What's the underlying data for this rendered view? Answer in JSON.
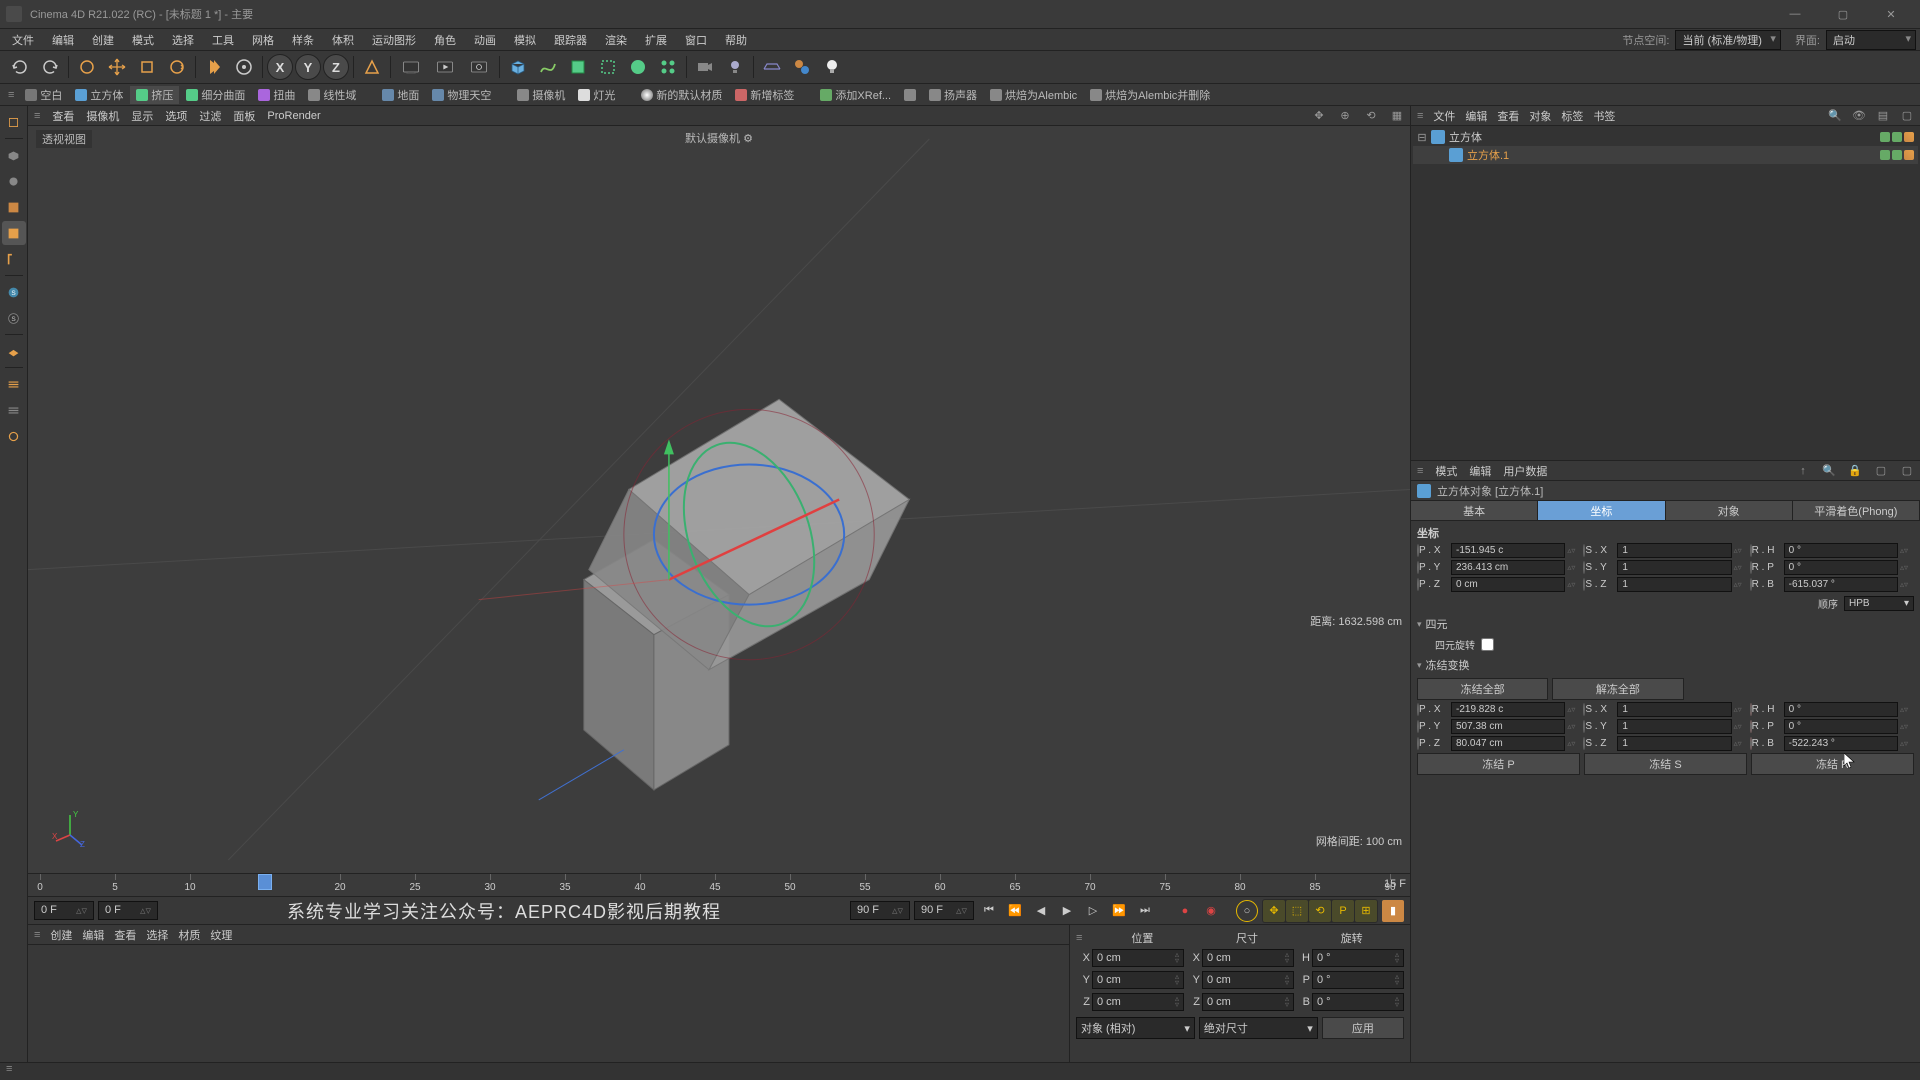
{
  "window": {
    "title": "Cinema 4D R21.022 (RC) - [未标题 1 *] - 主要"
  },
  "menu": {
    "items": [
      "文件",
      "编辑",
      "创建",
      "模式",
      "选择",
      "工具",
      "网格",
      "样条",
      "体积",
      "运动图形",
      "角色",
      "动画",
      "模拟",
      "跟踪器",
      "渲染",
      "扩展",
      "窗口",
      "帮助"
    ],
    "right_label1": "节点空间:",
    "right_drop1": "当前 (标准/物理)",
    "right_label2": "界面:",
    "right_drop2": "启动"
  },
  "subbar": {
    "items": [
      "空白",
      "立方体",
      "挤压",
      "细分曲面",
      "扭曲",
      "线性域",
      "地面",
      "物理天空",
      "摄像机",
      "灯光",
      "新的默认材质",
      "新增标签",
      "添加XRef...",
      "扬声器",
      "烘焙为Alembic",
      "烘焙为Alembic并删除"
    ]
  },
  "left_tools": [
    "live-select",
    "move",
    "rotate",
    "scale",
    "model",
    "texture",
    "workplane",
    "snap-a",
    "snap-b",
    "brush",
    "layer-a",
    "layer-b",
    "script"
  ],
  "view_header": {
    "items": [
      "查看",
      "摄像机",
      "显示",
      "选项",
      "过滤",
      "面板",
      "ProRender"
    ]
  },
  "viewport": {
    "label": "透视视图",
    "camera": "默认摄像机 ⚙",
    "distance": "距离: 1632.598 cm",
    "grid": "网格间距: 100 cm"
  },
  "timeline": {
    "start_field": "0 F",
    "pos_field": "0 F",
    "end_field": "90 F",
    "len_field": "90 F",
    "end_label": "15 F",
    "ticks": [
      0,
      5,
      10,
      15,
      20,
      25,
      30,
      35,
      40,
      45,
      50,
      55,
      60,
      65,
      70,
      75,
      80,
      85,
      90
    ],
    "overlay": "系统专业学习关注公众号：AEPRC4D影视后期教程"
  },
  "mat_header": {
    "items": [
      "创建",
      "编辑",
      "查看",
      "选择",
      "材质",
      "纹理"
    ]
  },
  "coord": {
    "headers": [
      "位置",
      "尺寸",
      "旋转"
    ],
    "rows": [
      {
        "axis": "X",
        "pos": "0 cm",
        "size": "0 cm",
        "rot_label": "H",
        "rot": "0 °"
      },
      {
        "axis": "Y",
        "pos": "0 cm",
        "size": "0 cm",
        "rot_label": "P",
        "rot": "0 °"
      },
      {
        "axis": "Z",
        "pos": "0 cm",
        "size": "0 cm",
        "rot_label": "B",
        "rot": "0 °"
      }
    ],
    "drop1": "对象 (相对)",
    "drop2": "绝对尺寸",
    "apply": "应用"
  },
  "obj_header": {
    "items": [
      "文件",
      "编辑",
      "查看",
      "对象",
      "标签",
      "书签"
    ]
  },
  "obj_tree": [
    {
      "name": "立方体",
      "level": 0,
      "expand": "⊟",
      "selected": false
    },
    {
      "name": "立方体.1",
      "level": 1,
      "expand": "",
      "selected": true
    }
  ],
  "attr_header": {
    "items": [
      "模式",
      "编辑",
      "用户数据"
    ]
  },
  "attr_title": "立方体对象 [立方体.1]",
  "attr_tabs": [
    "基本",
    "坐标",
    "对象",
    "平滑着色(Phong)"
  ],
  "attr_active_tab": 1,
  "attr_coord": {
    "title": "坐标",
    "rows": [
      {
        "pl": "P . X",
        "pv": "-151.945 c",
        "sl": "S . X",
        "sv": "1",
        "rl": "R . H",
        "rv": "0 °"
      },
      {
        "pl": "P . Y",
        "pv": "236.413 cm",
        "sl": "S . Y",
        "sv": "1",
        "rl": "R . P",
        "rv": "0 °"
      },
      {
        "pl": "P . Z",
        "pv": "0 cm",
        "sl": "S . Z",
        "sv": "1",
        "rl": "R . B",
        "rv": "-615.037 °"
      }
    ],
    "order_label": "顺序",
    "order_val": "HPB",
    "quat_title": "四元",
    "quat_check": "四元旋转",
    "freeze_title": "冻结变换",
    "freeze_all": "冻结全部",
    "unfreeze_all": "解冻全部",
    "frows": [
      {
        "pl": "P . X",
        "pv": "-219.828 c",
        "sl": "S . X",
        "sv": "1",
        "rl": "R . H",
        "rv": "0 °"
      },
      {
        "pl": "P . Y",
        "pv": "507.38 cm",
        "sl": "S . Y",
        "sv": "1",
        "rl": "R . P",
        "rv": "0 °"
      },
      {
        "pl": "P . Z",
        "pv": "80.047 cm",
        "sl": "S . Z",
        "sv": "1",
        "rl": "R . B",
        "rv": "-522.243 °"
      }
    ],
    "freeze_p": "冻结 P",
    "freeze_s": "冻结 S",
    "freeze_r": "冻结 R"
  }
}
